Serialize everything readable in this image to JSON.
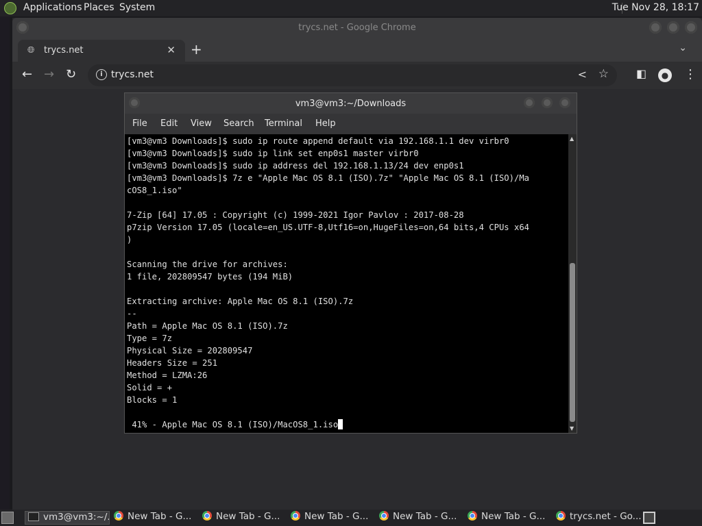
{
  "topbar": {
    "menus": [
      "Applications",
      "Places",
      "System"
    ],
    "clock": "Tue Nov 28, 18:17"
  },
  "chrome": {
    "window_title": "trycs.net - Google Chrome",
    "tab_title": "trycs.net",
    "address": "trycs.net"
  },
  "terminal": {
    "title": "vm3@vm3:~/Downloads",
    "menu": [
      "File",
      "Edit",
      "View",
      "Search",
      "Terminal",
      "Help"
    ],
    "lines": [
      "[vm3@vm3 Downloads]$ sudo ip route append default via 192.168.1.1 dev virbr0",
      "[vm3@vm3 Downloads]$ sudo ip link set enp0s1 master virbr0",
      "[vm3@vm3 Downloads]$ sudo ip address del 192.168.1.13/24 dev enp0s1",
      "[vm3@vm3 Downloads]$ 7z e \"Apple Mac OS 8.1 (ISO).7z\" \"Apple Mac OS 8.1 (ISO)/Ma",
      "cOS8_1.iso\"",
      "",
      "7-Zip [64] 17.05 : Copyright (c) 1999-2021 Igor Pavlov : 2017-08-28",
      "p7zip Version 17.05 (locale=en_US.UTF-8,Utf16=on,HugeFiles=on,64 bits,4 CPUs x64",
      ")",
      "",
      "Scanning the drive for archives:",
      "1 file, 202809547 bytes (194 MiB)",
      "",
      "Extracting archive: Apple Mac OS 8.1 (ISO).7z",
      "--",
      "Path = Apple Mac OS 8.1 (ISO).7z",
      "Type = 7z",
      "Physical Size = 202809547",
      "Headers Size = 251",
      "Method = LZMA:26",
      "Solid = +",
      "Blocks = 1",
      ""
    ],
    "progress_line": " 41% - Apple Mac OS 8.1 (ISO)/MacOS8_1.iso"
  },
  "taskbar": {
    "items": [
      "vm3@vm3:~/...",
      "New Tab - G...",
      "New Tab - G...",
      "New Tab - G...",
      "New Tab - G...",
      "New Tab - G...",
      "trycs.net - Go..."
    ]
  }
}
